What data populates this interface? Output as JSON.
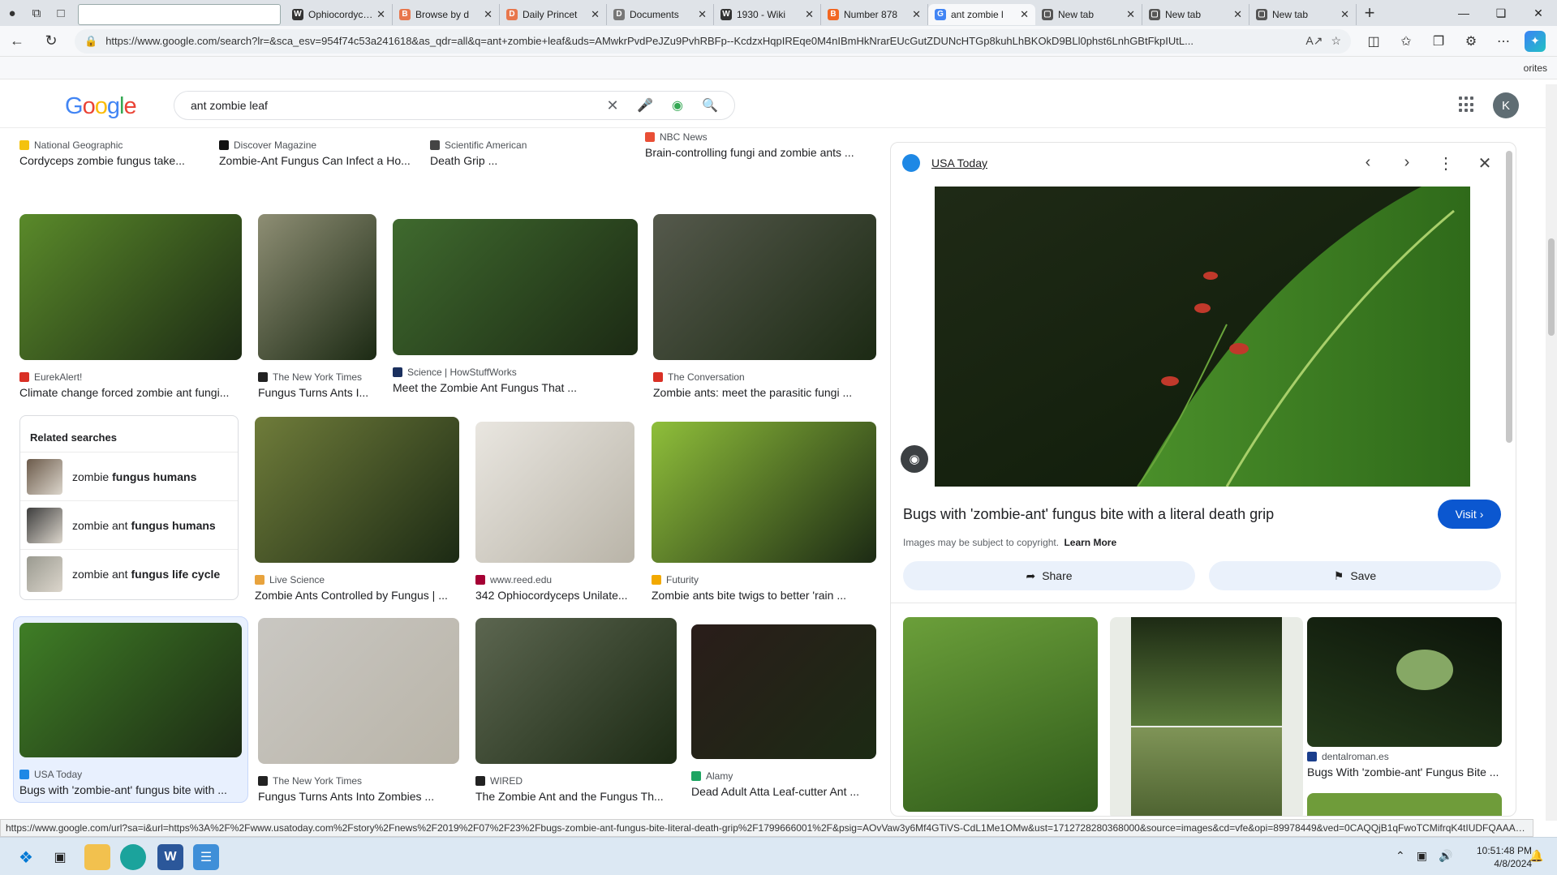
{
  "browser": {
    "tabs": [
      {
        "title": "",
        "favicon": "",
        "color": "#ffffff",
        "blank": true
      },
      {
        "title": "Ophiocordyceps",
        "favicon": "W",
        "color": "#333333"
      },
      {
        "title": "Browse by d",
        "favicon": "B",
        "color": "#e8774d"
      },
      {
        "title": "Daily Princet",
        "favicon": "D",
        "color": "#e8774d"
      },
      {
        "title": "Documents",
        "favicon": "D",
        "color": "#777777"
      },
      {
        "title": "1930 - Wiki",
        "favicon": "W",
        "color": "#333333"
      },
      {
        "title": "Number 878",
        "favicon": "B",
        "color": "#f26722"
      },
      {
        "title": "ant zombie l",
        "favicon": "G",
        "color": "#4285f4",
        "active": true
      },
      {
        "title": "New tab",
        "favicon": "▢",
        "color": "#555555"
      },
      {
        "title": "New tab",
        "favicon": "▢",
        "color": "#555555"
      },
      {
        "title": "New tab",
        "favicon": "▢",
        "color": "#555555"
      }
    ],
    "url": "https://www.google.com/search?lr=&sca_esv=954f74c53a241618&as_qdr=all&q=ant+zombie+leaf&uds=AMwkrPvdPeJZu9PvhRBFp--KcdzxHqpIREqe0M4nIBmHkNrarEUcGutZDUNcHTGp8kuhLhBKOkD9BLl0phst6LnhGBtFkpIUtL...",
    "favorites_label": "orites"
  },
  "google": {
    "logo": [
      "G",
      "o",
      "o",
      "g",
      "l",
      "e"
    ],
    "logo_colors": [
      "#4285f4",
      "#ea4335",
      "#fbbc05",
      "#4285f4",
      "#34a853",
      "#ea4335"
    ],
    "query": "ant zombie leaf",
    "avatar": "K"
  },
  "results": [
    {
      "source": "National Geographic",
      "caption": "Cordyceps zombie fungus take...",
      "color": "#f4c20d",
      "img": "#2c3024"
    },
    {
      "source": "Discover Magazine",
      "caption": "Zombie-Ant Fungus Can Infect a Ho...",
      "color": "#111111",
      "img": "#9aa450"
    },
    {
      "source": "Scientific American",
      "caption": "Death Grip ...",
      "color": "#444444",
      "img": "#a9b47a"
    },
    {
      "source": "NBC News",
      "caption": "Brain-controlling fungi and zombie ants ...",
      "color": "#e94f36",
      "img": "#8a8a4a"
    },
    {
      "source": "EurekAlert!",
      "caption": "Climate change forced zombie ant fungi...",
      "color": "#d93025",
      "img": "#5a8a2a"
    },
    {
      "source": "The New York Times",
      "caption": "Fungus Turns Ants I...",
      "color": "#222222",
      "img": "#8e8e74"
    },
    {
      "source": "Science | HowStuffWorks",
      "caption": "Meet the Zombie Ant Fungus That ...",
      "color": "#1a2f5e",
      "img": "#3f6a2e"
    },
    {
      "source": "The Conversation",
      "caption": "Zombie ants: meet the parasitic fungi ...",
      "color": "#d93025",
      "img": "#55594c"
    },
    {
      "source": "Live Science",
      "caption": "Zombie Ants Controlled by Fungus | ...",
      "color": "#e8a33d",
      "img": "#6f7c3a"
    },
    {
      "source": "www.reed.edu",
      "caption": "342 Ophiocordyceps Unilate...",
      "color": "#a50034",
      "img": "#e9e6e0"
    },
    {
      "source": "Futurity",
      "caption": "Zombie ants bite twigs to better 'rain ...",
      "color": "#f2a900",
      "img": "#8fbf3a"
    },
    {
      "source": "USA Today",
      "caption": "Bugs with 'zombie-ant' fungus bite with ...",
      "color": "#1e88e5",
      "img": "#3f7e26",
      "selected": true
    },
    {
      "source": "The New York Times",
      "caption": "Fungus Turns Ants Into Zombies ...",
      "color": "#222222",
      "img": "#c9c7c2"
    },
    {
      "source": "WIRED",
      "caption": "The Zombie Ant and the Fungus Th...",
      "color": "#222222",
      "img": "#5c6650"
    },
    {
      "source": "Alamy",
      "caption": "Dead Adult Atta Leaf-cutter Ant ...",
      "color": "#1da462",
      "img": "#2a1d1a"
    }
  ],
  "related": {
    "heading": "Related searches",
    "items": [
      {
        "prefix": "zombie",
        "bold": "fungus humans"
      },
      {
        "prefix": "zombie ant",
        "bold": "fungus humans"
      },
      {
        "prefix": "zombie ant",
        "bold": "fungus life cycle"
      }
    ]
  },
  "preview": {
    "site": "USA Today",
    "title": "Bugs with 'zombie-ant' fungus bite with a literal death grip",
    "visit_label": "Visit",
    "copyright": "Images may be subject to copyright.",
    "learn_more": "Learn More",
    "share_label": "Share",
    "save_label": "Save",
    "related_source": "dentalroman.es",
    "related_caption": "Bugs With 'zombie-ant' Fungus Bite ..."
  },
  "status_url": "https://www.google.com/url?sa=i&url=https%3A%2F%2Fwww.usatoday.com%2Fstory%2Fnews%2F2019%2F07%2F23%2Fbugs-zombie-ant-fungus-bite-literal-death-grip%2F1799666001%2F&psig=AOvVaw3y6Mf4GTiVS-CdL1Me1OMw&ust=1712728280368000&source=images&cd=vfe&opi=89978449&ved=0CAQQjB1qFwoTCMifrqK4tIUDFQAAAAA...",
  "taskbar": {
    "time": "10:51:48 PM",
    "date": "4/8/2024"
  }
}
